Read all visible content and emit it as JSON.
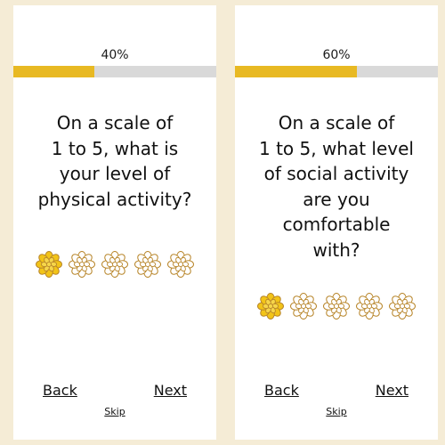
{
  "colors": {
    "background": "#f5ecd6",
    "accent": "#e8b923",
    "track": "#d9d9d9",
    "flower_outline": "#b8862b",
    "flower_fill_selected": "#f2c418"
  },
  "screens": [
    {
      "progress_label": "40%",
      "progress_value": 0.4,
      "question_lines": [
        "On a scale of",
        "1 to 5, what is",
        "your level of",
        "physical activity?"
      ],
      "rating": {
        "max": 5,
        "selected": 1,
        "icon": "flower-icon"
      },
      "back_label": "Back",
      "next_label": "Next",
      "skip_label": "Skip"
    },
    {
      "progress_label": "60%",
      "progress_value": 0.6,
      "question_lines": [
        "On a scale of",
        "1 to 5, what level",
        "of social activity",
        "are you",
        "comfortable",
        "with?"
      ],
      "rating": {
        "max": 5,
        "selected": 1,
        "icon": "flower-icon"
      },
      "back_label": "Back",
      "next_label": "Next",
      "skip_label": "Skip"
    }
  ]
}
